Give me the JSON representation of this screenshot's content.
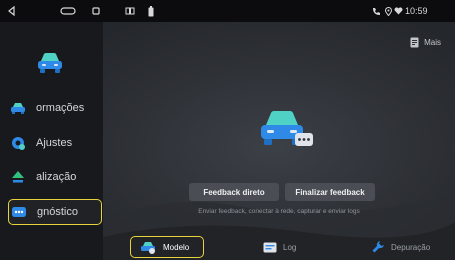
{
  "status_bar": {
    "icons": [
      "nav-back-icon",
      "nav-home-icon",
      "nav-recents-icon",
      "split-screen-icon",
      "battery-icon",
      "phone-icon",
      "location-icon",
      "heart-icon"
    ],
    "time": "10:59"
  },
  "sidebar": {
    "items": [
      {
        "label": "ormações",
        "icon": "car-info-icon",
        "color": "#2e8ae6"
      },
      {
        "label": "Ajustes",
        "icon": "settings-icon",
        "color": "#2e8ae6"
      },
      {
        "label": "alização",
        "icon": "update-icon",
        "color": "#2ec27e"
      },
      {
        "label": "gnóstico",
        "icon": "diagnostic-icon",
        "color": "#2e8ae6",
        "selected": true
      }
    ]
  },
  "header": {
    "more_label": "Mais"
  },
  "main": {
    "feedback_label": "Feedback direto",
    "finish_label": "Finalizar feedback",
    "hint": "Enviar feedback, conectar à rede, capturar e enviar logs"
  },
  "tabs": [
    {
      "label": "Modelo",
      "icon": "car-model-icon",
      "selected": true
    },
    {
      "label": "Log",
      "icon": "log-icon",
      "selected": false
    },
    {
      "label": "Depuração",
      "icon": "wrench-icon",
      "selected": false
    }
  ],
  "colors": {
    "accent": "#e7d33a",
    "primary": "#2e8ae6",
    "teal": "#4fd1c5",
    "green": "#2ec27e"
  }
}
